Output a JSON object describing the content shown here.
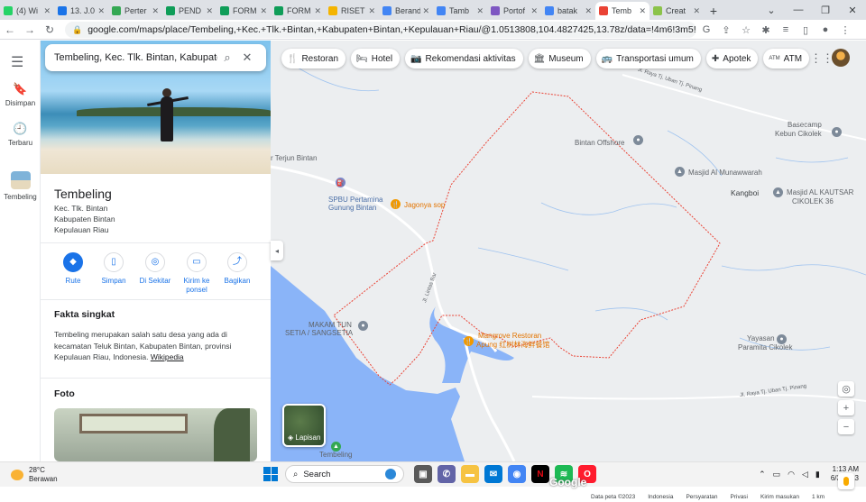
{
  "browser": {
    "tabs": [
      {
        "label": "(4) Wi",
        "color": "#25d366"
      },
      {
        "label": "13. J.0",
        "color": "#1a73e8"
      },
      {
        "label": "Perter",
        "color": "#34a853"
      },
      {
        "label": "PEND",
        "color": "#0f9d58"
      },
      {
        "label": "FORM",
        "color": "#0f9d58"
      },
      {
        "label": "FORM",
        "color": "#0f9d58"
      },
      {
        "label": "RISET",
        "color": "#f4b400"
      },
      {
        "label": "Berand",
        "color": "#4285f4"
      },
      {
        "label": "Tamb",
        "color": "#4285f4"
      },
      {
        "label": "Portof",
        "color": "#7e57c2"
      },
      {
        "label": "batak",
        "color": "#4285f4"
      },
      {
        "label": "Temb",
        "color": "#ea4335",
        "active": true
      },
      {
        "label": "Creat",
        "color": "#8bc34a"
      }
    ],
    "url": "google.com/maps/place/Tembeling,+Kec.+Tlk.+Bintan,+Kabupaten+Bintan,+Kepulauan+Riau/@1.0513808,104.4827425,13.78z/data=!4m6!3m5!1s0x31d96519d81bd1b3:0x2a..."
  },
  "rail": {
    "saved": "Disimpan",
    "recent": "Terbaru",
    "place": "Tembeling"
  },
  "panel": {
    "search_value": "Tembeling, Kec. Tlk. Bintan, Kabupaten",
    "title": "Tembeling",
    "addr_line1": "Kec. Tlk. Bintan",
    "addr_line2": "Kabupaten Bintan",
    "addr_line3": "Kepulauan Riau",
    "actions": {
      "route": "Rute",
      "save": "Simpan",
      "nearby": "Di Sekitar",
      "send_line1": "Kirim ke",
      "send_line2": "ponsel",
      "share": "Bagikan"
    },
    "facts_title": "Fakta singkat",
    "facts_text": "Tembeling merupakan salah satu desa yang ada di kecamatan Teluk Bintan, Kabupaten Bintan, provinsi Kepulauan Riau, Indonesia. ",
    "facts_link": "Wikipedia",
    "foto_title": "Foto"
  },
  "chips": [
    {
      "icon": "fork-knife-icon",
      "glyph": "🍴",
      "label": "Restoran"
    },
    {
      "icon": "bed-icon",
      "glyph": "🛏",
      "label": "Hotel"
    },
    {
      "icon": "camera-icon",
      "glyph": "📷",
      "label": "Rekomendasi aktivitas"
    },
    {
      "icon": "museum-icon",
      "glyph": "🏛",
      "label": "Museum"
    },
    {
      "icon": "bus-icon",
      "glyph": "🚌",
      "label": "Transportasi umum"
    },
    {
      "icon": "pharmacy-icon",
      "glyph": "✚",
      "label": "Apotek"
    },
    {
      "icon": "atm-icon",
      "glyph": "ATM",
      "label": "ATM"
    }
  ],
  "map": {
    "labels": {
      "terjun": "r Terjun Bintan",
      "spbu_1": "SPBU Pertamina",
      "spbu_2": "Gunung Bintan",
      "jagonya": "Jagonya sop",
      "offshore": "Bintan Offshore",
      "basecamp_1": "Basecamp",
      "basecamp_2": "Kebun Cikolek",
      "masjid_mun": "Masjid Al Munawwarah",
      "kangboi": "Kangboi",
      "masjid_kau_1": "Masjid AL KAUTSAR",
      "masjid_kau_2": "CIKOLEK 36",
      "makam_1": "MAKAM TUN",
      "makam_2": "SETIA / SANGSETIA",
      "mangrove_1": "Mangrove Restoran",
      "mangrove_2": "Apung 红树林海鲜餐馆",
      "yayasan_1": "Yayasan",
      "yayasan_2": "Paramita Cikolek",
      "tembeling": "Tembeling",
      "road_1": "Jl. Raya Tj. Uban Tj. Pinang",
      "road_2": "Jl. Lintas Bar",
      "road_3": "Jl. Raya Tj. Uban Tj. Pinang"
    },
    "layers_label": "Lapisan",
    "google_logo": "Google",
    "footer": {
      "data": "Data peta ©2023",
      "country": "Indonesia",
      "terms": "Persyaratan",
      "privacy": "Privasi",
      "feedback": "Kirim masukan",
      "scale": "1 km"
    }
  },
  "taskbar": {
    "temp": "28°C",
    "weather": "Berawan",
    "search": "Search",
    "time": "1:13 AM",
    "date": "6/3/2023"
  }
}
